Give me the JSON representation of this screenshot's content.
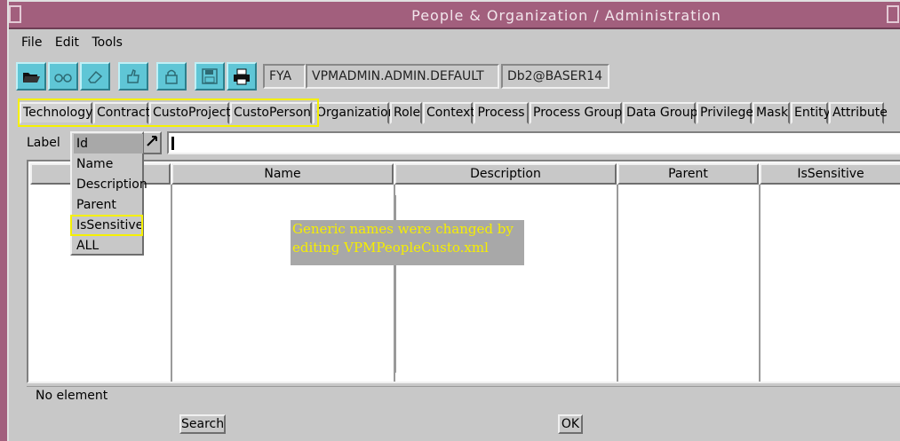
{
  "window": {
    "title": "People & Organization / Administration"
  },
  "menu": [
    {
      "label": "File"
    },
    {
      "label": "Edit"
    },
    {
      "label": "Tools"
    }
  ],
  "toolbar": {
    "icons": [
      "open-folder-icon",
      "glasses-icon",
      "eraser-icon",
      "thumbs-up-icon",
      "lock-icon",
      "save-disk-icon",
      "printer-icon"
    ],
    "site": "FYA",
    "context": "VPMADMIN.ADMIN.DEFAULT",
    "database": "Db2@BASER14"
  },
  "tabs": [
    "Technology",
    "Contract",
    "CustoProject",
    "CustoPerson",
    "Organization",
    "Role",
    "Context",
    "Process",
    "Process Group",
    "Data Group",
    "Privilege",
    "Mask",
    "Entity",
    "Attribute"
  ],
  "search": {
    "label": "Label",
    "options": [
      "Id",
      "Name",
      "Description",
      "Parent",
      "IsSensitive",
      "ALL"
    ],
    "selected_option": "Id",
    "value": ""
  },
  "table": {
    "columns": [
      "",
      "Name",
      "Description",
      "Parent",
      "IsSensitive"
    ]
  },
  "annotation": {
    "line1": "Generic names were changed by",
    "line2": "editing VPMPeopleCusto.xml"
  },
  "status": "No element",
  "buttons": {
    "search": "Search",
    "ok": "OK"
  },
  "colors": {
    "title_bar": "#a25f7d",
    "toolbar_button": "#5fc6d6",
    "highlight": "#f5f000",
    "annotation_text": "#f6ee00"
  }
}
